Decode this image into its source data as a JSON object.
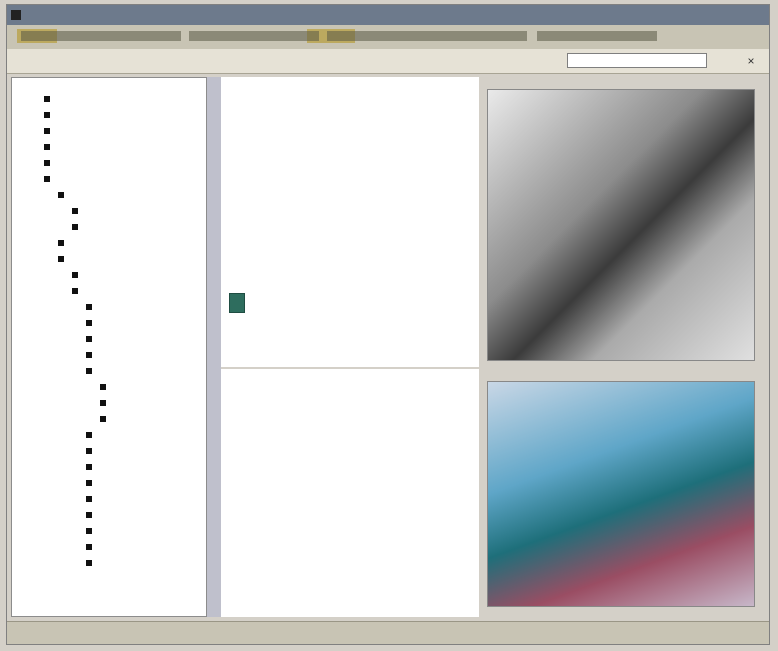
{
  "window": {
    "title": ""
  },
  "menubar": {
    "items": [
      "",
      "",
      "",
      "",
      "",
      ""
    ]
  },
  "toolbar": {
    "left_text": "",
    "right_label": "",
    "search_placeholder": "",
    "close_icon": "×"
  },
  "sidebar": {
    "items": [
      {
        "label": ""
      },
      {
        "label": ""
      },
      {
        "label": ""
      },
      {
        "label": ""
      },
      {
        "label": ""
      },
      {
        "label": ""
      },
      {
        "label": ""
      },
      {
        "label": ""
      },
      {
        "label": ""
      },
      {
        "label": ""
      },
      {
        "label": ""
      },
      {
        "label": ""
      },
      {
        "label": ""
      },
      {
        "label": ""
      },
      {
        "label": ""
      },
      {
        "label": ""
      },
      {
        "label": ""
      },
      {
        "label": ""
      },
      {
        "label": ""
      },
      {
        "label": ""
      },
      {
        "label": ""
      },
      {
        "label": ""
      },
      {
        "label": ""
      },
      {
        "label": ""
      },
      {
        "label": ""
      },
      {
        "label": ""
      },
      {
        "label": ""
      },
      {
        "label": ""
      },
      {
        "label": ""
      },
      {
        "label": ""
      }
    ]
  },
  "content": {
    "paragraphs": [
      "",
      "",
      ""
    ],
    "link_label": "",
    "lower_heading": "",
    "lower_paragraphs": [
      "",
      ""
    ]
  },
  "status": {
    "left": "",
    "right": ""
  }
}
